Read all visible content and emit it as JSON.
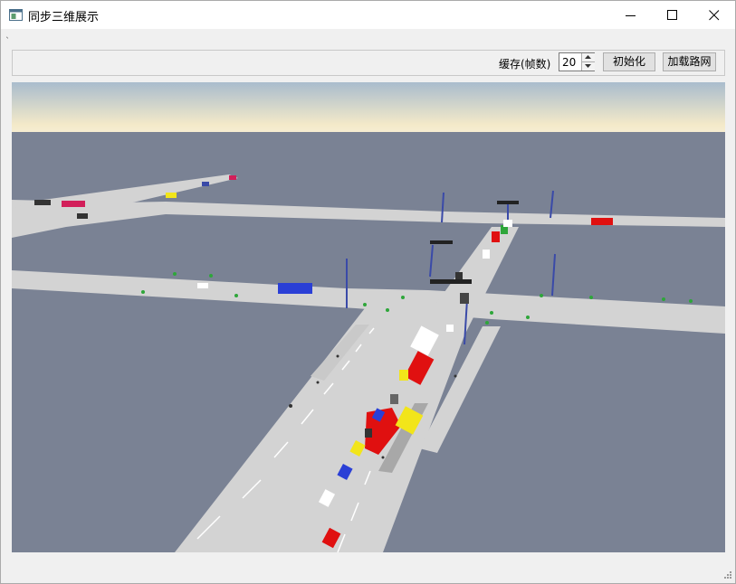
{
  "window": {
    "title": "同步三维展示",
    "icon": "window-app-icon",
    "controls": [
      "minimize-icon",
      "maximize-icon",
      "close-icon"
    ]
  },
  "toolbar": {
    "cache_label": "缓存(帧数)",
    "cache_value": "20",
    "init_button": "初始化",
    "load_network_button": "加载路网"
  },
  "viewport": {
    "description_icon": "3d-traffic-scene",
    "colors": {
      "sky_top": "#a9bccd",
      "sky_horizon": "#f3e9c9",
      "ground": "#7a8294",
      "road": "#d3d3d3",
      "lane_marking": "#ffffff",
      "bus_red": "#e01010",
      "bus_blue": "#2a3fd6",
      "car_yellow": "#f2e51a",
      "pole": "#3a4aa8"
    }
  }
}
